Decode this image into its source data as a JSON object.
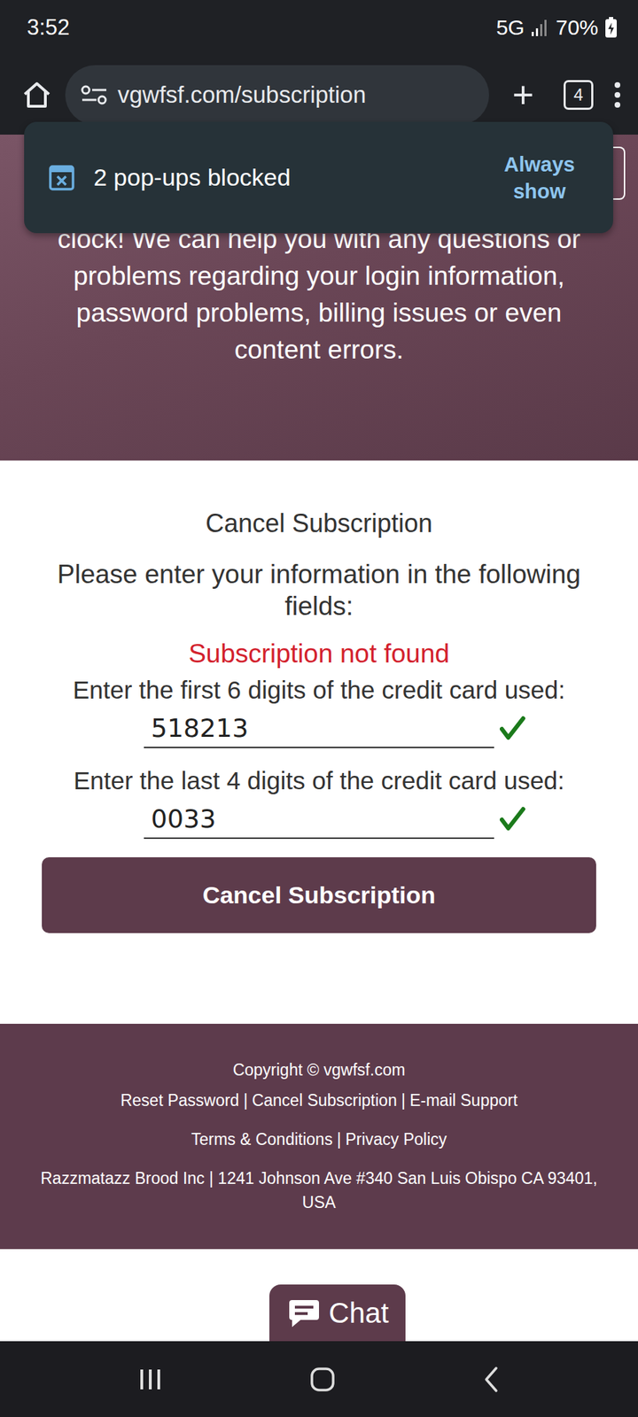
{
  "status_bar": {
    "time": "3:52",
    "network": "5G",
    "battery": "70%"
  },
  "browser": {
    "url": "vgwfsf.com/subscription",
    "new_tab": "+",
    "tab_count": "4"
  },
  "popup_toast": {
    "message": "2 pop-ups blocked",
    "action": "Always show"
  },
  "hero": {
    "text": "clock! We can help you with any questions or problems regarding your login information, password problems, billing issues or even content errors."
  },
  "form": {
    "title": "Cancel Subscription",
    "instructions": "Please enter your information in the following fields:",
    "error": "Subscription not found",
    "fields": [
      {
        "label": "Enter the first 6 digits of the credit card used:",
        "value": "518213",
        "valid": true
      },
      {
        "label": "Enter the last 4 digits of the credit card used:",
        "value": "0033",
        "valid": true
      }
    ],
    "submit": "Cancel Subscription"
  },
  "footer": {
    "copyright": "Copyright © vgwfsf.com",
    "separator": "|",
    "links": [
      "Reset Password",
      "Cancel Subscription",
      "E-mail Support"
    ],
    "legal_links": [
      "Terms & Conditions",
      "Privacy Policy"
    ],
    "address": "Razzmatazz Brood Inc | 1241 Johnson Ave #340 San Luis Obispo CA 93401, USA"
  },
  "chat": {
    "label": "Chat"
  }
}
